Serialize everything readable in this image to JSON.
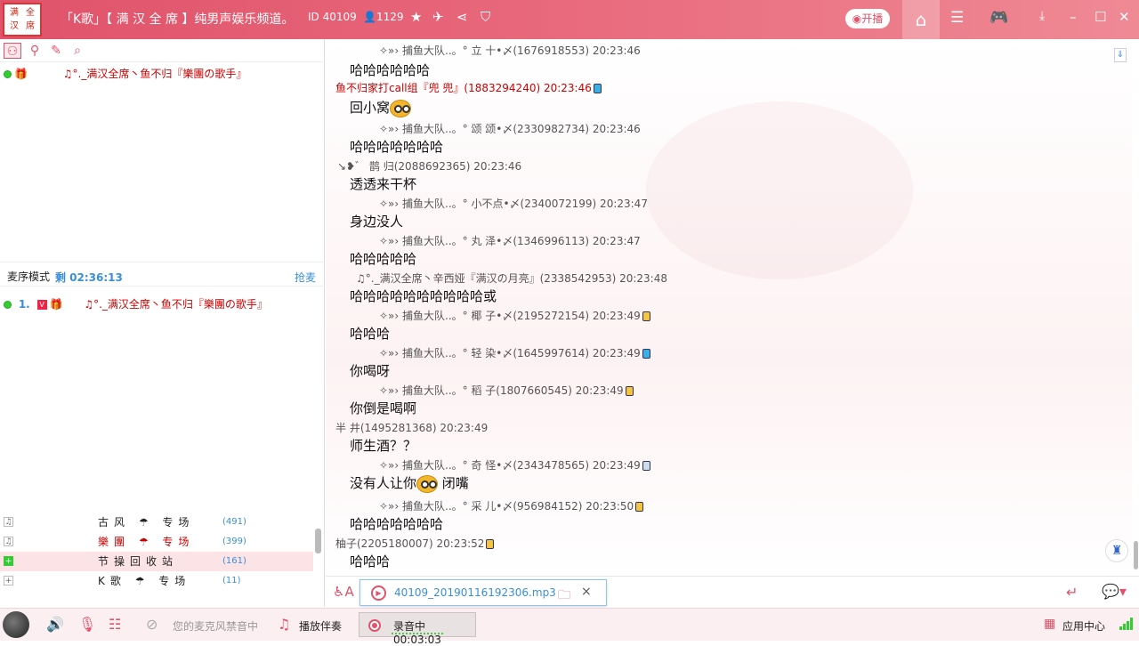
{
  "titlebar": {
    "logo_chars": [
      "满",
      "全",
      "汉",
      "席"
    ],
    "title": "「K歌」【 满 汉 全 席 】纯男声娱乐频道。",
    "channel_id": "ID 40109",
    "member_count": "1129",
    "live_button": "开播"
  },
  "left": {
    "top_user": {
      "nick": "♫°._满汉全席丶鱼不归『樂團の歌手』"
    },
    "queue": {
      "title": "麦序模式",
      "timer": "剩 02:36:13",
      "grab": "抢麦",
      "entry_num": "1.",
      "entry_nick": "♫°._满汉全席丶鱼不归『樂團の歌手』"
    },
    "channels": [
      {
        "name": "古风 ☂ 专场",
        "count": "(491)"
      },
      {
        "name": "樂團 ☂ 专场",
        "count": "(399)"
      },
      {
        "name": "节操回收站",
        "count": "(161)"
      },
      {
        "name": "K歌 ☂ 专场",
        "count": "(11)"
      }
    ]
  },
  "chat": {
    "lines": [
      {
        "meta": "✧»› 捕鱼大队..。° 立  十•〆(1676918553) 20:23:46",
        "msg": "哈哈哈哈哈哈"
      },
      {
        "meta": "鱼不归家打call组『兜 兜』(1883294240) 20:23:46",
        "msg": "回小窝"
      },
      {
        "meta": "✧»› 捕鱼大队..。° 颂  颂•〆(2330982734) 20:23:46",
        "msg": "哈哈哈哈哈哈哈"
      },
      {
        "meta": "↘❥゛ 鹊 归(2088692365) 20:23:46",
        "msg": "透透来干杯"
      },
      {
        "meta": "✧»› 捕鱼大队..。° 小不点•〆(2340072199) 20:23:47",
        "msg": "身边没人"
      },
      {
        "meta": "✧»› 捕鱼大队..。° 丸  泽•〆(1346996113) 20:23:47",
        "msg": "哈哈哈哈哈"
      },
      {
        "meta": "♫°._满汉全席丶辛西娅『满汉の月亮』(2338542953) 20:23:48",
        "msg": "哈哈哈哈哈哈哈哈哈哈或"
      },
      {
        "meta": "✧»› 捕鱼大队..。° 椰  子•〆(2195272154) 20:23:49",
        "msg": "哈哈哈"
      },
      {
        "meta": "✧»› 捕鱼大队..。° 轻  染•〆(1645997614) 20:23:49",
        "msg": "你喝呀"
      },
      {
        "meta": "✧»› 捕鱼大队..。° 稻  子(1807660545) 20:23:49",
        "msg": "你倒是喝啊"
      },
      {
        "meta": "半  井(1495281368) 20:23:49",
        "msg": "师生酒？？"
      },
      {
        "meta": "✧»› 捕鱼大队..。° 奇 怪•〆(2343478565) 20:23:49",
        "msg": "没有人让你"
      },
      {
        "meta": "✧»› 捕鱼大队..。° 采  儿•〆(956984152) 20:23:50",
        "msg": "哈哈哈哈哈哈哈"
      },
      {
        "meta": "柚子(2205180007) 20:23:52",
        "msg": "哈哈哈"
      }
    ],
    "msg12_suffix": " 闭嘴"
  },
  "input": {
    "file_name": "40109_20190116192306.mp3"
  },
  "bottom": {
    "mic_status": "您的麦克风禁音中",
    "accompaniment": "播放伴奏",
    "recording": "录音中 00:03:03",
    "app_center": "应用中心"
  },
  "colors": {
    "accent": "#e0536a",
    "link_blue": "#3a8fd8",
    "online_green": "#33cc33"
  }
}
